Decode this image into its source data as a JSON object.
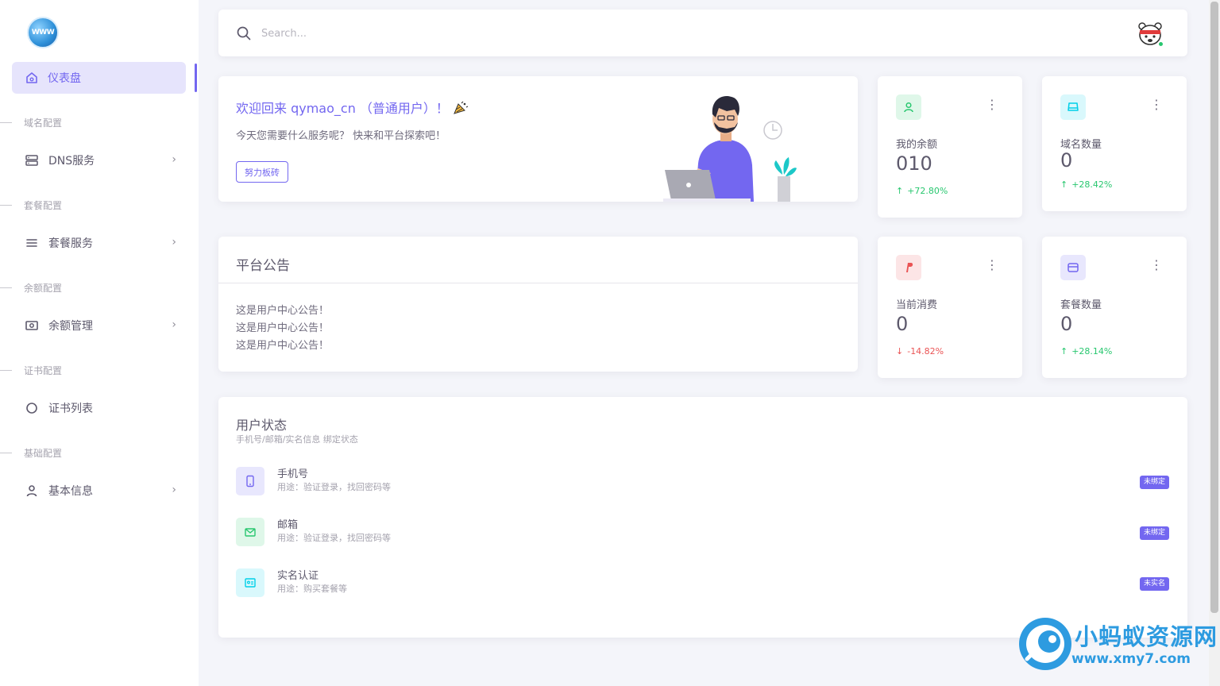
{
  "sidebar": {
    "logo_text": "WWW",
    "active_item": {
      "label": "仪表盘",
      "icon": "home-icon"
    },
    "sections": [
      {
        "label": "域名配置",
        "item": {
          "label": "DNS服务",
          "icon": "server-icon",
          "has_submenu": true
        }
      },
      {
        "label": "套餐配置",
        "item": {
          "label": "套餐服务",
          "icon": "list-icon",
          "has_submenu": true
        }
      },
      {
        "label": "余额配置",
        "item": {
          "label": "余额管理",
          "icon": "cash-icon",
          "has_submenu": true
        }
      },
      {
        "label": "证书配置",
        "item": {
          "label": "证书列表",
          "icon": "circle-icon",
          "has_submenu": false
        }
      },
      {
        "label": "基础配置",
        "item": {
          "label": "基本信息",
          "icon": "user-icon",
          "has_submenu": true
        }
      }
    ],
    "chevron": "›"
  },
  "topbar": {
    "search_placeholder": "Search...",
    "avatar_icon": "avatar-icon"
  },
  "welcome": {
    "title": "欢迎回来 qymao_cn （普通用户）！",
    "title_icon": "party-popper-icon",
    "subtitle": "今天您需要什么服务呢？ 快来和平台探索吧！",
    "button_label": "努力板砖"
  },
  "stats": [
    {
      "label": "我的余额",
      "value": "010",
      "trend": "+72.80%",
      "direction": "up",
      "icon": "user-icon",
      "color": "#28c76f",
      "icon_bg": "#dff7e9"
    },
    {
      "label": "域名数量",
      "value": "0",
      "trend": "+28.42%",
      "direction": "up",
      "icon": "drive-icon",
      "color": "#00cfe8",
      "icon_bg": "#d9f8fc"
    },
    {
      "label": "当前消费",
      "value": "0",
      "trend": "-14.82%",
      "direction": "down",
      "icon": "paypal-icon",
      "color": "#ea5455",
      "icon_bg": "#fce5e6"
    },
    {
      "label": "套餐数量",
      "value": "0",
      "trend": "+28.14%",
      "direction": "up",
      "icon": "wallet-icon",
      "color": "#7367f0",
      "icon_bg": "#e8e7fd"
    }
  ],
  "notice": {
    "title": "平台公告",
    "lines": [
      "这是用户中心公告！",
      "这是用户中心公告！",
      "这是用户中心公告！"
    ]
  },
  "user_status": {
    "title": "用户状态",
    "subtitle": "手机号/邮箱/实名信息 绑定状态",
    "rows": [
      {
        "name": "手机号",
        "desc": "用途：验证登录，找回密码等",
        "badge": "未绑定",
        "icon": "phone-icon",
        "color": "#7367f0",
        "icon_bg": "#e8e7fd"
      },
      {
        "name": "邮箱",
        "desc": "用途：验证登录，找回密码等",
        "badge": "未绑定",
        "icon": "mail-icon",
        "color": "#28c76f",
        "icon_bg": "#dff7e9"
      },
      {
        "name": "实名认证",
        "desc": "用途：购买套餐等",
        "badge": "未实名",
        "icon": "id-card-icon",
        "color": "#00cfe8",
        "icon_bg": "#d9f8fc"
      }
    ]
  },
  "watermark": {
    "title": "小蚂蚁资源网",
    "url": "www.xmy7.com"
  },
  "colors": {
    "primary": "#7367f0",
    "success": "#28c76f",
    "danger": "#ea5455",
    "info": "#00cfe8"
  }
}
